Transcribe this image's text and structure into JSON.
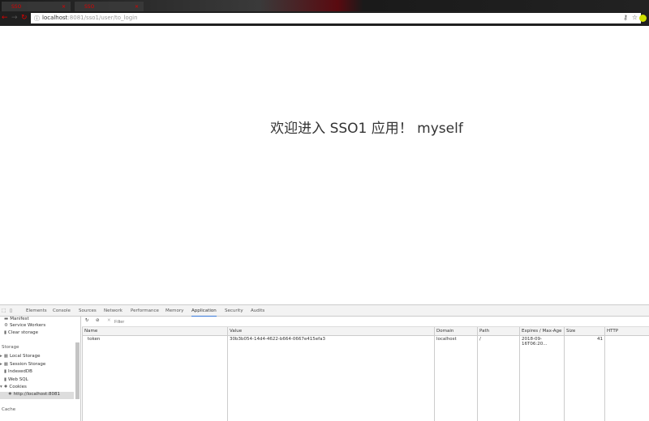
{
  "browser": {
    "tabs": [
      {
        "title": "SSO"
      },
      {
        "title": "SSO"
      }
    ],
    "url_host": "localhost",
    "url_path": ":8081/sso1/user/to_login"
  },
  "page": {
    "welcome": "欢迎进入 SSO1 应用！ myself"
  },
  "devtools": {
    "tabs": [
      "Elements",
      "Console",
      "Sources",
      "Network",
      "Performance",
      "Memory",
      "Application",
      "Security",
      "Audits"
    ],
    "active_tab": "Application",
    "sidebar": {
      "items": [
        "Manifest",
        "Service Workers",
        "Clear storage"
      ],
      "storage_header": "Storage",
      "storage_items": [
        "Local Storage",
        "Session Storage",
        "IndexedDB",
        "Web SQL",
        "Cookies"
      ],
      "cookie_origin": "http://localhost:8081",
      "cache_header": "Cache"
    },
    "filter_placeholder": "Filter",
    "columns": [
      "Name",
      "Value",
      "Domain",
      "Path",
      "Expires / Max-Age",
      "Size",
      "HTTP"
    ],
    "rows": [
      {
        "name": "token",
        "value": "30b3b054-14d4-4622-b664-0667e415efa3",
        "domain": "localhost",
        "path": "/",
        "expires": "2018-09-16T06:20...",
        "size": "41",
        "http": ""
      }
    ]
  }
}
